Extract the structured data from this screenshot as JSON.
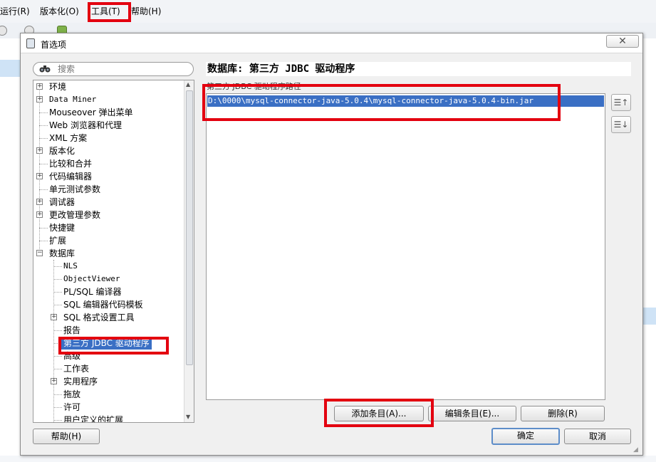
{
  "menubar": {
    "items": [
      "运行(R)",
      "版本化(O)",
      "工具(T)",
      "帮助(H)"
    ]
  },
  "dialog": {
    "title": "首选项",
    "close_glyph": "✕",
    "search": {
      "placeholder": "搜索"
    },
    "tree": [
      {
        "label": "环境"
      },
      {
        "label": "Data Miner"
      },
      {
        "label": "Mouseover 弹出菜单"
      },
      {
        "label": "Web 浏览器和代理"
      },
      {
        "label": "XML 方案"
      },
      {
        "label": "版本化"
      },
      {
        "label": "比较和合并"
      },
      {
        "label": "代码编辑器"
      },
      {
        "label": "单元测试参数"
      },
      {
        "label": "调试器"
      },
      {
        "label": "更改管理参数"
      },
      {
        "label": "快捷键"
      },
      {
        "label": "扩展"
      },
      {
        "label": "数据库"
      },
      {
        "label": "NLS"
      },
      {
        "label": "ObjectViewer"
      },
      {
        "label": "PL/SQL 编译器"
      },
      {
        "label": "SQL 编辑器代码模板"
      },
      {
        "label": "SQL 格式设置工具"
      },
      {
        "label": "报告"
      },
      {
        "label": "第三方 JDBC 驱动程序"
      },
      {
        "label": "高级"
      },
      {
        "label": "工作表"
      },
      {
        "label": "实用程序"
      },
      {
        "label": "拖放"
      },
      {
        "label": "许可"
      },
      {
        "label": "用户定义的扩展"
      }
    ],
    "panel_title": "数据库: 第三方 JDBC 驱动程序",
    "section_label": "第三方 JDBC 驱动程序路径",
    "driver_paths": [
      "D:\\0000\\mysql-connector-java-5.0.4\\mysql-connector-java-5.0.4-bin.jar"
    ],
    "move_up_glyph": "☰↑",
    "move_down_glyph": "☰↓",
    "buttons": {
      "add": "添加条目(A)...",
      "edit": "编辑条目(E)...",
      "delete": "删除(R)",
      "help": "帮助(H)",
      "ok": "确定",
      "cancel": "取消"
    }
  },
  "colors": {
    "selection": "#3a6fc4",
    "highlight_box": "#e3000f",
    "dialog_bg": "#f0f0f0"
  }
}
